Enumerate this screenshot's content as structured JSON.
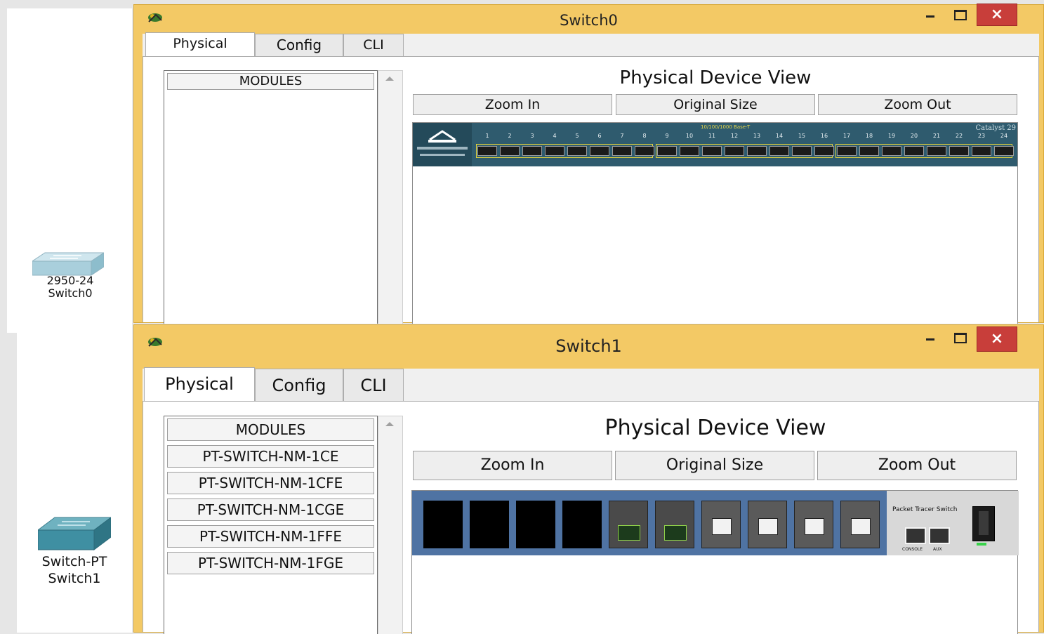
{
  "canvas": {
    "device0": {
      "model": "2950-24",
      "name": "Switch0"
    },
    "device1": {
      "model": "Switch-PT",
      "name": "Switch1"
    }
  },
  "switch0_window": {
    "title": "Switch0",
    "close_symbol": "×",
    "tabs": [
      "Physical",
      "Config",
      "CLI"
    ],
    "active_tab": "Physical",
    "modules_header": "MODULES",
    "modules": [],
    "view_title": "Physical Device View",
    "zoom_in": "Zoom In",
    "original_size": "Original Size",
    "zoom_out": "Zoom Out",
    "device_image": {
      "group_label": "10/100/1000 Base-T",
      "brand_label": "Catalyst 29",
      "port_numbers": [
        "1",
        "2",
        "3",
        "4",
        "5",
        "6",
        "7",
        "8",
        "9",
        "10",
        "11",
        "12",
        "13",
        "14",
        "15",
        "16",
        "17",
        "18",
        "19",
        "20",
        "21",
        "22",
        "23",
        "24"
      ]
    }
  },
  "switch1_window": {
    "title": "Switch1",
    "close_symbol": "×",
    "tabs": [
      "Physical",
      "Config",
      "CLI"
    ],
    "active_tab": "Physical",
    "modules_header": "MODULES",
    "modules": [
      "PT-SWITCH-NM-1CE",
      "PT-SWITCH-NM-1CFE",
      "PT-SWITCH-NM-1CGE",
      "PT-SWITCH-NM-1FFE",
      "PT-SWITCH-NM-1FGE"
    ],
    "view_title": "Physical Device View",
    "zoom_in": "Zoom In",
    "original_size": "Original Size",
    "zoom_out": "Zoom Out",
    "device_image": {
      "brand_label": "Packet Tracer Switch",
      "console_label": "CONSOLE",
      "aux_label": "AUX"
    }
  },
  "colors": {
    "window_frame": "#f3c965",
    "close_button": "#c83e3a",
    "switch0_chassis": "#2f5b6e",
    "switch1_chassis": "#4f73a3",
    "port_highlight": "#e2d23a"
  },
  "icons": [
    "packet-tracer-app-icon",
    "minimize-icon",
    "maximize-icon",
    "close-icon",
    "scroll-up-arrow-icon",
    "switch-device-icon"
  ]
}
